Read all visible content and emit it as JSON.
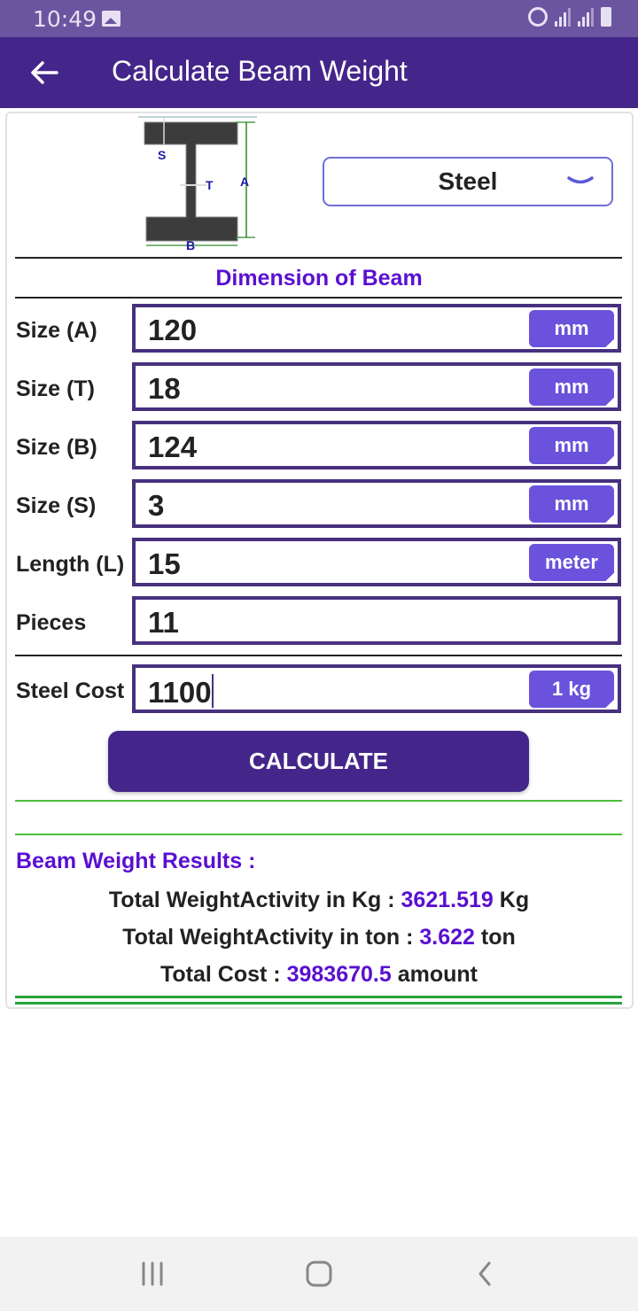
{
  "status_bar": {
    "time": "10:49",
    "icons": [
      "image-icon",
      "alarm-icon",
      "signal-icon",
      "signal-icon",
      "battery-charging-icon"
    ]
  },
  "app_bar": {
    "back_icon": "arrow-left-icon",
    "title": "Calculate Beam Weight"
  },
  "diagram": {
    "labels": {
      "s": "S",
      "t": "T",
      "a": "A",
      "b": "B"
    }
  },
  "material_select": {
    "selected": "Steel",
    "icon": "chevron-down-icon"
  },
  "section_title": "Dimension of Beam",
  "fields": [
    {
      "label": "Size (A)",
      "value": "120",
      "unit": "mm"
    },
    {
      "label": "Size (T)",
      "value": "18",
      "unit": "mm"
    },
    {
      "label": "Size (B)",
      "value": "124",
      "unit": "mm"
    },
    {
      "label": "Size (S)",
      "value": "3",
      "unit": "mm"
    },
    {
      "label": "Length (L)",
      "value": "15",
      "unit": "meter"
    },
    {
      "label": "Pieces",
      "value": "11",
      "unit": null
    }
  ],
  "cost_field": {
    "label": "Steel Cost",
    "value": "1100",
    "unit": "1 kg"
  },
  "calculate_button": "CALCULATE",
  "results": {
    "title": "Beam Weight Results :",
    "lines": [
      {
        "prefix": "Total WeightActivity in Kg : ",
        "value": "3621.519",
        "suffix": " Kg"
      },
      {
        "prefix": "Total WeightActivity in ton : ",
        "value": "3.622",
        "suffix": " ton"
      },
      {
        "prefix": "Total Cost : ",
        "value": "3983670.5",
        "suffix": " amount"
      }
    ]
  },
  "colors": {
    "primary": "#44268a",
    "status_bar": "#6b55a0",
    "accent_text": "#5a0fd0",
    "unit_chip": "#6a52dc",
    "divider_green": "#4cbf3a"
  },
  "nav_bar": {
    "icons": [
      "recent-apps-icon",
      "home-icon",
      "back-icon"
    ]
  }
}
